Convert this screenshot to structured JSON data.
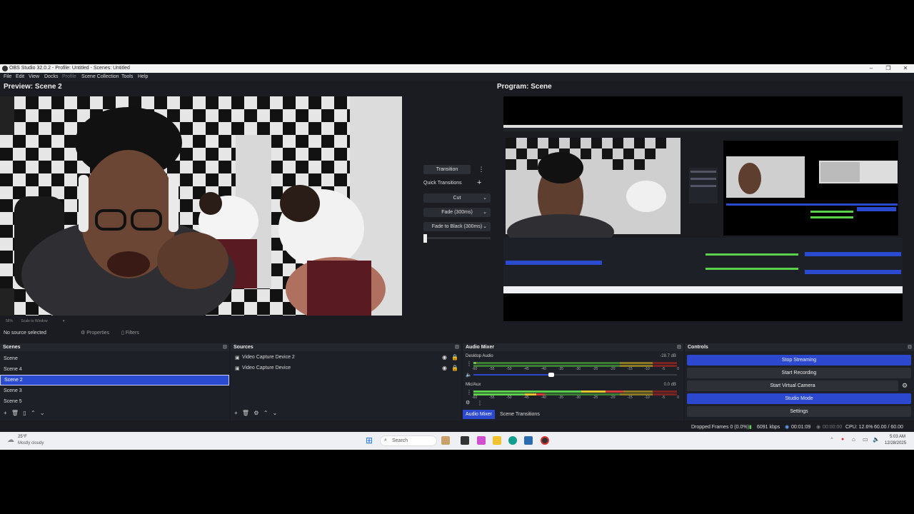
{
  "window": {
    "title": "OBS Studio 32.0.2 - Profile: Untitled - Scenes: Untitled",
    "controls": [
      "–",
      "❐",
      "✕"
    ]
  },
  "menu": [
    "File",
    "Edit",
    "View",
    "Docks",
    "Profile",
    "Scene Collection",
    "Tools",
    "Help"
  ],
  "preview": {
    "heading": "Preview: Scene 2",
    "zoom": "56%",
    "scale_mode": "Scale to Window"
  },
  "program": {
    "heading": "Program: Scene"
  },
  "transitions": {
    "transition_button": "Transition",
    "quick_label": "Quick Transitions",
    "items": [
      "Cut",
      "Fade (300ms)",
      "Fade to Black (300ms)"
    ]
  },
  "source_toolbar": {
    "no_source": "No source selected",
    "properties": "Properties",
    "filters": "Filters"
  },
  "scenes": {
    "title": "Scenes",
    "items": [
      "Scene",
      "Scene 4",
      "Scene 2",
      "Scene 3",
      "Scene 5"
    ],
    "selected": "Scene 2"
  },
  "sources": {
    "title": "Sources",
    "items": [
      "Video Capture Device 2",
      "Video Capture Device"
    ]
  },
  "audio_mixer": {
    "title": "Audio Mixer",
    "channels": [
      {
        "name": "Desktop Audio",
        "db": "-28.7 dB"
      },
      {
        "name": "Mic/Aux",
        "db": "0.0 dB"
      }
    ],
    "scale": [
      "-60",
      "-55",
      "-50",
      "-45",
      "-40",
      "-35",
      "-30",
      "-25",
      "-20",
      "-15",
      "-10",
      "-5",
      "0"
    ],
    "tabs": [
      "Audio Mixer",
      "Scene Transitions"
    ]
  },
  "controls": {
    "title": "Controls",
    "buttons": [
      "Stop Streaming",
      "Start Recording",
      "Start Virtual Camera",
      "Studio Mode",
      "Settings"
    ]
  },
  "status": {
    "dropped_frames": "Dropped Frames 0 (0.0%)",
    "bitrate": "6091 kbps",
    "stream_time": "00:01:09",
    "rec_time": "00:00:00",
    "cpu": "CPU: 12.6%",
    "fps": "60.00 / 60.00 FPS"
  },
  "taskbar": {
    "weather_temp": "25°F",
    "weather_desc": "Mostly cloudy",
    "search": "Search",
    "time": "5:03 AM",
    "date": "12/28/2025"
  },
  "colors": {
    "accent": "#2b48cf",
    "panel_bg": "#1b1c22",
    "dock_bg": "#1e2027"
  }
}
